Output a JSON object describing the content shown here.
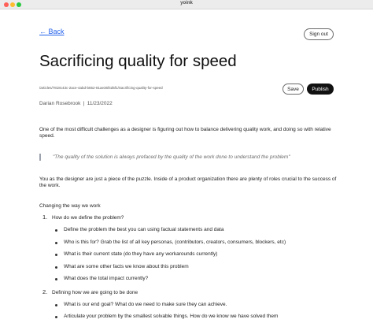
{
  "window": {
    "title": "yoink"
  },
  "nav": {
    "back_label": "← Back",
    "signout_label": "Sign out"
  },
  "article": {
    "title": "Sacrificing quality for speed",
    "slug": "/articles/7818c43c-2ace-4abd-b652-81ae36f4d5f1/Sacrificing-quality-for-speed",
    "author": "Darian Rosebrook",
    "separator": "|",
    "date": "11/23/2022",
    "intro": "One of the most difficult challenges as a designer is figuring out how to balance delivering quality work, and doing so with relative speed.",
    "quote": "\"The quality of the solution is always prefaced by the quality of the work done to understand the problem\"",
    "para2": "You as the designer are just a piece of the puzzle. Inside of a product organization there are plenty of roles crucial to the success of the work.",
    "section_heading": "Changing the way we work",
    "list": [
      {
        "number": "1.",
        "label": "How do we define the problem?",
        "subitems": [
          "Define the problem the best you can using factual statements and data",
          "Who is this for? Grab the list of all key personas, (contributors, creators, consumers, blockers, etc)",
          "What is their current state (do they have any workarounds currently)",
          "What are some other facts we know about this problem",
          "What does the total impact currently?"
        ]
      },
      {
        "number": "2.",
        "label": "Defining how we are going to be done",
        "subitems": [
          "What is our end goal? What do we need to make sure they can achieve.",
          "Articulate your problem by the smallest solvable things. How do we know we have solved them"
        ]
      }
    ]
  },
  "editor": {
    "save_label": "Save",
    "publish_label": "Publish"
  },
  "colors": {
    "link": "#2563eb",
    "primary_button": "#111111",
    "quote_bar": "#9ca3af"
  }
}
